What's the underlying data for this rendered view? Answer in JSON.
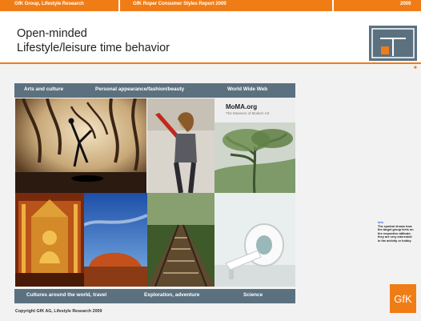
{
  "header": {
    "left": "GfK Group, Lifestyle Research",
    "center": "GfK Roper Consumer Styles Report 2009",
    "right": "2009"
  },
  "title": {
    "line1": "Open-minded",
    "line2": "Lifestyle/leisure time behavior"
  },
  "grid": {
    "top_labels": [
      "Arts and culture",
      "Personal appearance/fashion/beauty",
      "World Wide Web"
    ],
    "bottom_labels": [
      "Cultures around the world, travel",
      "Exploration, adventure",
      "Science"
    ],
    "moma_title": "MoMA.org",
    "moma_subtitle": "The Museum of Modern Art"
  },
  "footer": {
    "copyright": "Copyright GfK AG, Lifestyle Research 2009"
  },
  "side_note": {
    "heading": "Info",
    "body": "The symbol shows how the target group feels on the respective attitude; they are very interested in the activity or hobby"
  },
  "brand": {
    "logo_text": "GfK",
    "accent_color": "#f07c16",
    "strip_color": "#5c7180"
  }
}
